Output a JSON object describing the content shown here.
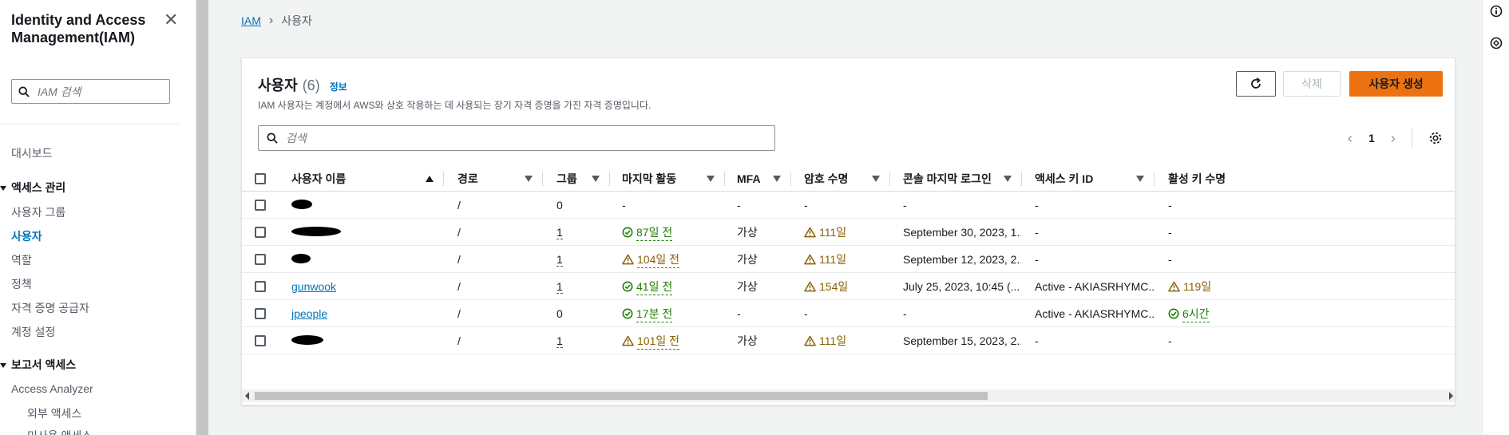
{
  "sidebar": {
    "title": "Identity and Access Management(IAM)",
    "search_placeholder": "IAM 검색",
    "dashboard": "대시보드",
    "access_mgmt_section": "액세스 관리",
    "items": [
      "사용자 그룹",
      "사용자",
      "역할",
      "정책",
      "자격 증명 공급자",
      "계정 설정"
    ],
    "active_item": "사용자",
    "report_section": "보고서 액세스",
    "access_analyzer": "Access Analyzer",
    "sub_items": [
      "외부 액세스",
      "미사용 액세스"
    ]
  },
  "breadcrumb": {
    "root": "IAM",
    "current": "사용자"
  },
  "panel": {
    "title": "사용자",
    "count": "(6)",
    "info": "정보",
    "description": "IAM 사용자는 계정에서 AWS와 상호 작용하는 데 사용되는 장기 자격 증명을 가진 자격 증명입니다.",
    "delete_label": "삭제",
    "create_label": "사용자 생성",
    "search_placeholder": "검색",
    "page": "1"
  },
  "table": {
    "headers": [
      "사용자 이름",
      "경로",
      "그룹",
      "마지막 활동",
      "MFA",
      "암호 수명",
      "콘솔 마지막 로그인",
      "액세스 키 ID",
      "활성 키 수명"
    ],
    "rows": [
      {
        "name": "",
        "redacted": true,
        "path": "/",
        "groups": "0",
        "groups_link": false,
        "activity": "-",
        "activity_status": "none",
        "mfa": "-",
        "pw_age": "-",
        "pw_status": "none",
        "console": "-",
        "key_id": "-",
        "key_age": "-",
        "key_status": "none"
      },
      {
        "name": "",
        "redacted": true,
        "path": "/",
        "groups": "1",
        "groups_link": true,
        "activity": "87일 전",
        "activity_status": "ok",
        "mfa": "가상",
        "pw_age": "111일",
        "pw_status": "warn",
        "console": "September 30, 2023, 1...",
        "key_id": "-",
        "key_age": "-",
        "key_status": "none"
      },
      {
        "name": "",
        "redacted": true,
        "path": "/",
        "groups": "1",
        "groups_link": true,
        "activity": "104일 전",
        "activity_status": "warn",
        "mfa": "가상",
        "pw_age": "111일",
        "pw_status": "warn",
        "console": "September 12, 2023, 2...",
        "key_id": "-",
        "key_age": "-",
        "key_status": "none"
      },
      {
        "name": "gunwook",
        "redacted": false,
        "path": "/",
        "groups": "1",
        "groups_link": true,
        "activity": "41일 전",
        "activity_status": "ok",
        "mfa": "가상",
        "pw_age": "154일",
        "pw_status": "warn",
        "console": "July 25, 2023, 10:45 (...",
        "key_id": "Active - AKIASRHYMC...",
        "key_age": "119일",
        "key_status": "warn"
      },
      {
        "name": "jpeople",
        "redacted": false,
        "path": "/",
        "groups": "0",
        "groups_link": false,
        "activity": "17분 전",
        "activity_status": "ok",
        "mfa": "-",
        "pw_age": "-",
        "pw_status": "none",
        "console": "-",
        "key_id": "Active - AKIASRHYMC...",
        "key_age": "6시간",
        "key_status": "ok"
      },
      {
        "name": "",
        "redacted": true,
        "path": "/",
        "groups": "1",
        "groups_link": true,
        "activity": "101일 전",
        "activity_status": "warn",
        "mfa": "가상",
        "pw_age": "111일",
        "pw_status": "warn",
        "console": "September 15, 2023, 2...",
        "key_id": "-",
        "key_age": "-",
        "key_status": "none"
      }
    ]
  },
  "icons": {
    "close": "close-icon",
    "search": "search-icon",
    "refresh": "refresh-icon",
    "settings": "gear-icon",
    "success": "check-circle-icon",
    "warning": "warning-triangle-icon"
  },
  "colors": {
    "link": "#0073bb",
    "primary_button": "#ec7211",
    "success": "#1d8102",
    "warning": "#8a6100"
  }
}
